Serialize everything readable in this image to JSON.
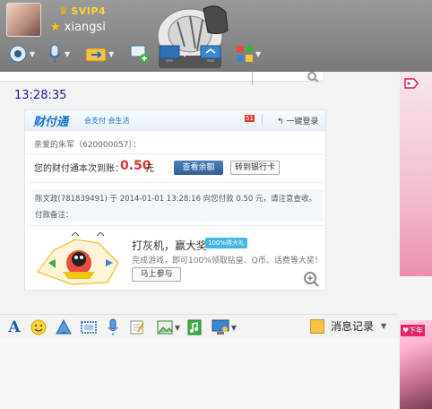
{
  "header": {
    "vip_label": "SVIP4",
    "nickname": "xiangsi",
    "toolbar": [
      {
        "icon": "camera-icon",
        "dropdown": true
      },
      {
        "icon": "microphone-icon",
        "dropdown": true
      },
      {
        "icon": "folder-transfer-icon",
        "dropdown": true
      },
      {
        "icon": "add-chat-icon",
        "dropdown": false
      },
      {
        "icon": "remote-desktop-icon",
        "dropdown": true
      },
      {
        "icon": "share-screen-icon",
        "dropdown": false
      },
      {
        "icon": "apps-grid-icon",
        "dropdown": true
      }
    ]
  },
  "chat": {
    "timestamp": "13:28:35",
    "card": {
      "logo": "财付通",
      "slogan": "会支付 会生活",
      "badge": "51",
      "login": "一键登录",
      "greeting": "亲爱的朱军（620000057）：",
      "received_label": "您的财付通本次到账：",
      "amount": "0.50",
      "amount_unit": "元",
      "check_balance": "查看余额",
      "to_bank": "转到银行卡",
      "detail": "陈文政(781839491) 于 2014-01-01 13:28:16 向您付款 0.50 元，请注意查收。",
      "remark": "付款备注：",
      "promo_title": "打灰机，赢大奖",
      "promo_badge": "100%得大礼",
      "promo_desc": "完成游戏，即可100%领取钻皇、Q币、话费等大奖！",
      "join": "马上参与"
    }
  },
  "input_toolbar": {
    "items": [
      "font-icon",
      "emoji-icon",
      "shake-icon",
      "screenshot-icon",
      "voice-icon",
      "note-icon",
      "image-icon",
      "music-icon",
      "screen-share-icon"
    ],
    "history_label": "消息记录"
  },
  "right_panel": {
    "photo_tag": "♥下年"
  },
  "colors": {
    "header": "#8a8a8a",
    "timestamp": "#1a1a9a",
    "amount": "#d6322b",
    "link_blue": "#1a74c9"
  }
}
